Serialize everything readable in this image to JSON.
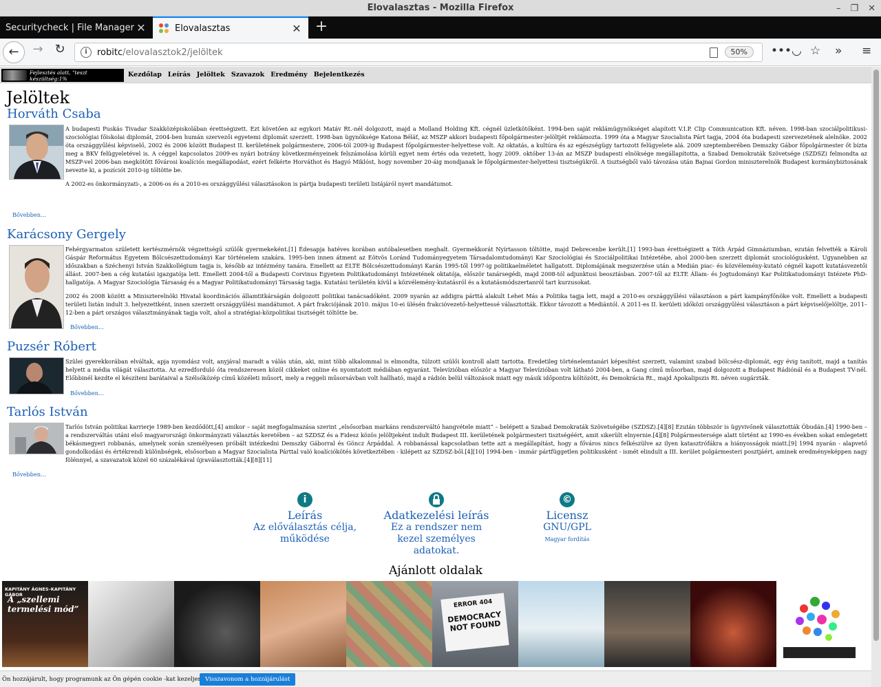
{
  "window": {
    "title": "Elovalasztas - Mozilla Firefox"
  },
  "tabs": [
    {
      "label": "Securitycheck | File Manager Co"
    },
    {
      "label": "Elovalasztas"
    }
  ],
  "urlbar": {
    "host": "robitc",
    "path": "/elovalasztok2/jelöltek",
    "zoom": "50%"
  },
  "site": {
    "banner": "Fejlesztés alatt, \"teszt készültség:1%",
    "menu": [
      "Kezdőlap",
      "Leírás",
      "Jelöltek",
      "Szavazok",
      "Eredmény",
      "Bejelentkezés"
    ],
    "page_title": "Jelöltek"
  },
  "candidates": [
    {
      "name": "Horváth Csaba",
      "bio": [
        "A budapesti Puskás Tivadar Szakközépiskolában érettségizett. Ezt követően az egykori Matáv Rt.-nél dolgozott, majd a Molland Holding Kft. cégnél üzletkötőként. 1994-ben saját reklámügynökséget alapított V.I.P. Clip Communication Kft. néven. 1998-ban szociálpolitikusi-szociológiai főiskolai diplomát, 2004-ben humán szervezői egyetemi diplomát szerzett. 1998-ban ügynöksége Katona Béláť, az MSZP akkori budapesti főpolgármester-jelöltjét reklámozta. 1999 óta a Magyar Szocialista Párt tagja, 2004 óta budapesti szervezetének alelnöke. 2002 óta országgyűlési képviselő, 2002 és 2006 között Budapest II. kerületének polgármestere, 2006-tól 2009-ig Budapest főpolgármester-helyettese volt. Az oktatás, a kultúra és az egészségügy tartozott felügyelete alá. 2009 szeptemberében Demszky Gábor főpolgármester őt bízta meg a BKV felügyeletével is. A céggel kapcsolatos 2009-es nyári botrány következményeinek felszámolása körüli egyet nem értés oda vezetett, hogy 2009. október 13-án az MSZP budapesti elnöksége megállapította, a Szabad Demokraták Szövetsége (SZDSZ) felmondta az MSZP-vel 2006-ban megkötött fővárosi koalíciós megállapodást, ezért felkérte Horváthot és Hagyó Miklóst, hogy november 20-áig mondjanak le főpolgármester-helyettesi tisztségükről. A tisztségből való távozása után Bajnai Gordon miniszterelnök Budapest kormánybiztosának nevezte ki, a pozíciót 2010-ig töltötte be.",
        "A 2002-es önkormányzati-, a 2006-os és a 2010-es országgyűlési választásokon is pártja budapesti területi listájáról nyert mandátumot."
      ],
      "more": "Bővebben..."
    },
    {
      "name": "Karácsony Gergely",
      "bio": [
        "Fehérgyarmaton született kertészmérnök végzettségű szülők gyermekeként.[1] Édesapja hatéves korában autóbalesetben meghalt. Gyermekkorát Nyírtasson töltötte, majd Debrecenbe került.[1] 1993-ban érettségizett a Tóth Árpád Gimnáziumban, ezután felvették a Károli Gáspár Református Egyetem Bölcsészettudományi Kar történelem szakára. 1995-ben innen átment az Eötvös Loránd Tudományegyetem Társadalomtudományi Kar Szociológiai és Szociálpolitikai Intézetébe, ahol 2000-ben szerzett diplomát szociológusként. Ugyanebben az időszakban a Széchenyi István Szakkollégium tagja is, később az intézmény tanára. Emellett az ELTE Bölcsészettudományi Karán 1995-től 1997-ig politikaelméletet hallgatott. Diplomájának megszerzése után a Medián piac- és közvélemény-kutató cégnél kapott kutatásvezetői állást. 2007-ben a cég kutatási igazgatója lett. Emellett 2004-től a Budapesti Corvinus Egyetem Politikatudományi Intézetének oktatója, először tanársegédi, majd 2008-tól adjunktusi beosztásban. 2007-től az ELTE Állam- és Jogtudományi Kar Politikatudományi Intézete PhD-hallgatója. A Magyar Szociológia Társaság és a Magyar Politikatudományi Társaság tagja. Kutatási területén kívül a közvélemény-kutatásról és a kutatásmódszertanról tart kurzusokat.",
        "2002 és 2008 között a Miniszterelnöki Hivatal koordinációs államtitkárságán dolgozott politikai tanácsadóként. 2009 nyarán az addigra párttá alakult Lehet Más a Politika tagja lett, majd a 2010-es országgyűlési választáson a párt kampányfőnöke volt. Emellett a budapesti területi listán indult 3. helyezettként, innen szerzett országgyűlési mandátumot. A párt frakciójának 2010. május 10-ei ülésén frakcióvezető-helyettessé választották. Ekkor távozott a Mediántól. A 2011-es II. kerületi időközi országgyűlési választáson a párt képviselőjelöltje, 2011–12-ben a párt országos választmányának tagja volt, ahol a stratégiai-közpolitikai tisztségét töltötte be."
      ],
      "more": "Bővebben..."
    },
    {
      "name": "Puzsér Róbert",
      "bio": [
        "Szülei gyerekkorában elváltak, apja nyomdász volt, anyjával maradt a válás után, aki, mint több alkalommal is elmondta, túlzott szülői kontroll alatt tartotta. Eredetileg történelemtanári képesítést szerzett, valamint szabad bölcsész-diplomát, egy évig tanított, majd a tanítás helyett a média világát választotta. Az ezredforduló óta rendszeresen közöl cikkeket online és nyomtatott médiában egyaránt. Televízióban először a Magyar Televízióban volt látható 2004-ben, a Gang című műsorban, majd dolgozott a Budapest Rádiónál és a Budapest TV-nél. Előbbinél kezdte el készíteni barátaival a Szélsőközép című közéleti műsort, mely a reggeli műsorsávban volt hallható, majd a rádión belül változások miatt egy másik időpontra költözött, és Demokrácia Rt., majd Apokalipszis Rt. néven sugárzták."
      ],
      "more": "Bővebben..."
    },
    {
      "name": "Tarlós István",
      "bio": [
        "Tarlós István politikai karrierje 1989-ben kezdődött,[4] amikor – saját megfogalmazása szerint „elsősorban markáns rendszerváltó hangvétele miatt” – belépett a Szabad Demokraták Szövetségébe (SZDSZ).[4][8] Ezután többször is ügyvivőnek választották Óbudán.[4] 1990-ben – a rendszerváltás utáni első magyarországi önkormányzati választás keretében – az SZDSZ és a Fidesz közös jelöltjeként indult Budapest III. kerületének polgármesteri tisztségéért, amit sikerült elnyernie.[4][8] Polgármestersége alatt történt az 1990-es években sokat emlegetett békásmegyeri robbanás, amelynek során személyesen próbált intézkedni Demszky Gáborral és Göncz Árpáddal. A robbanással kapcsolatban tette azt a megállapítást, hogy a főváros nincs felkészülve az ilyen katasztrófákra a hiányosságok miatt.[9] 1994 nyarán - alapvető gondolkodási és értékrendi különbségek, elsősorban a Magyar Szocialista Párttal való koalíciókötés következtében - kilépett az SZDSZ-ből.[4][10] 1994-ben - immár pártfüggetlen politikusként - ismét elindult a III. kerület polgármesteri posztjáért, aminek eredményeképpen nagy fölénnyel, a szavazatok közel 60 százalékával újraválasztották.[4][8][11]"
      ],
      "more": "Bővebben..."
    }
  ],
  "features": [
    {
      "icon": "info-icon",
      "title": "Leírás",
      "desc": "Az előválasztás célja, működése",
      "sub": ""
    },
    {
      "icon": "lock-icon",
      "title": "Adatkezelési leírás",
      "desc": "Ez a rendszer nem kezel személyes adatokat.",
      "sub": ""
    },
    {
      "icon": "copyright-icon",
      "title": "Licensz",
      "desc": "GNU/GPL",
      "sub": "Magyar fordítás"
    }
  ],
  "recommended": {
    "heading": "Ajánlott oldalak",
    "tiles": [
      {
        "caption": "KAPITÁNY ÁGNES–KAPITÁNY GÁBOR",
        "title": "A „szellemi termelési mód”"
      },
      {
        "caption": ""
      },
      {
        "caption": ""
      },
      {
        "caption": ""
      },
      {
        "caption": ""
      },
      {
        "caption": "ERROR 404",
        "title": "DEMOCRACY NOT FOUND"
      },
      {
        "caption": ""
      },
      {
        "caption": ""
      },
      {
        "caption": ""
      },
      {
        "caption": ""
      }
    ]
  },
  "cookie": {
    "message": "Ön hozzájárult, hogy programunk az Ön gépén cookie -kat kezeljen.",
    "button": "Visszavonom a hozzájárulást"
  },
  "colors": {
    "link": "#1a5fb4",
    "accent": "#0e7a86",
    "tab_highlight": "#0a84ff",
    "cookie_button": "#1a7fd8"
  }
}
